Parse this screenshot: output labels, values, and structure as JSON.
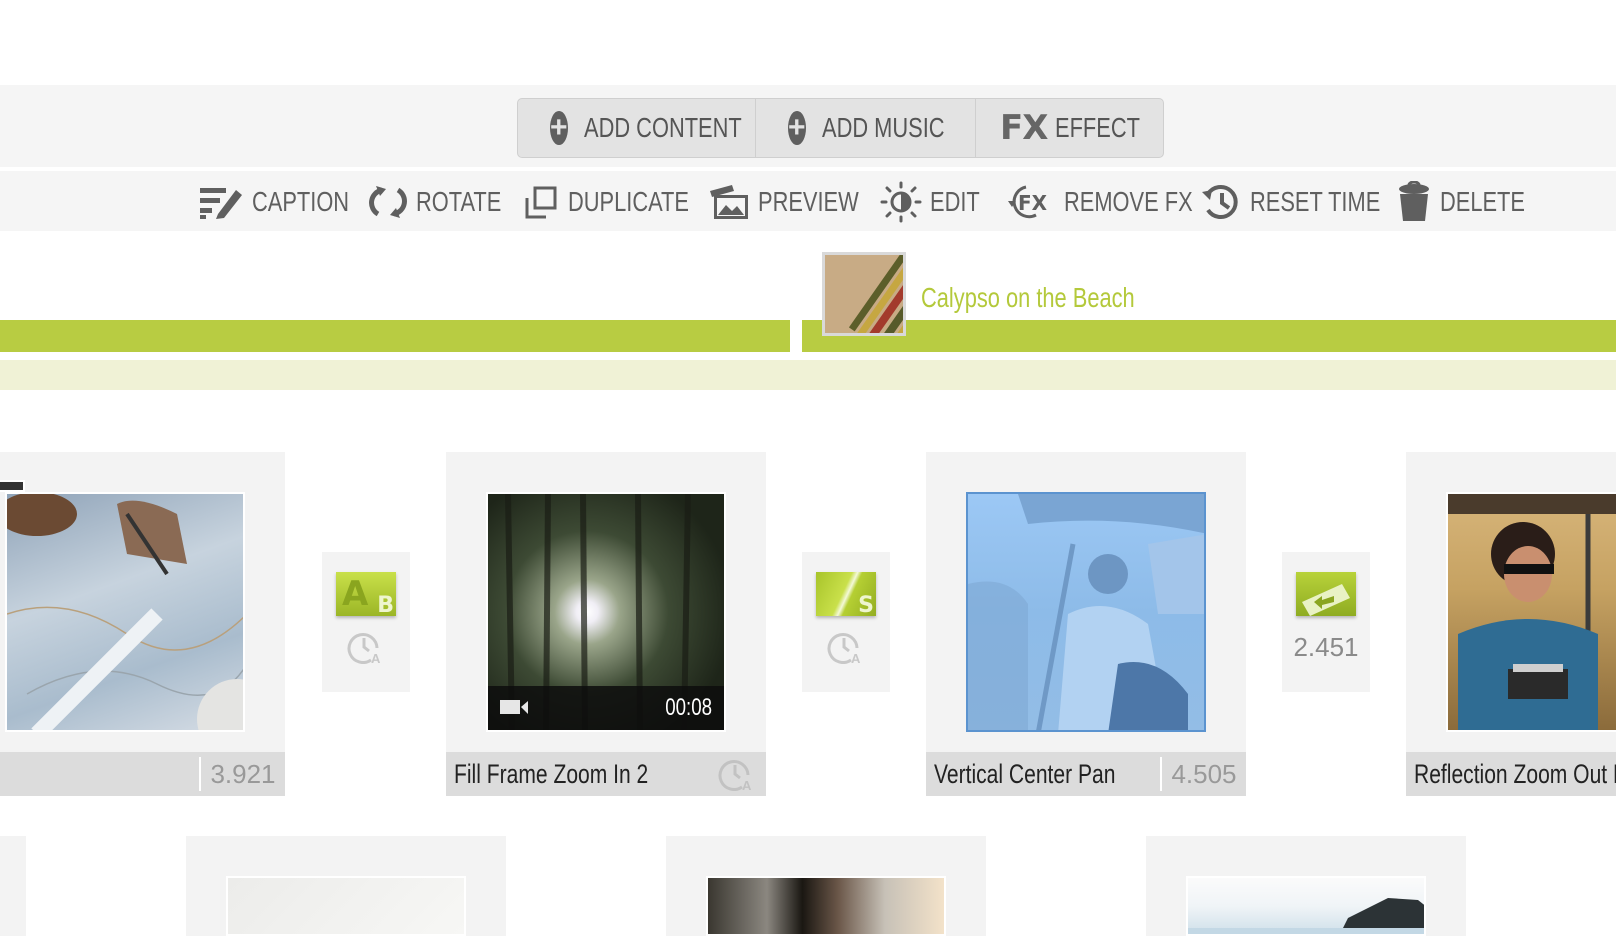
{
  "top_buttons": [
    {
      "label": "ADD CONTENT",
      "icon": "plus-circle-icon"
    },
    {
      "label": "ADD MUSIC",
      "icon": "plus-circle-icon"
    },
    {
      "label": "EFFECT",
      "icon": "fx-icon",
      "icon_text": "FX"
    }
  ],
  "toolbar": [
    {
      "label": "CAPTION",
      "icon": "caption-icon"
    },
    {
      "label": "ROTATE",
      "icon": "rotate-icon"
    },
    {
      "label": "DUPLICATE",
      "icon": "duplicate-icon"
    },
    {
      "label": "PREVIEW",
      "icon": "preview-icon"
    },
    {
      "label": "EDIT",
      "icon": "brightness-icon"
    },
    {
      "label": "REMOVE FX",
      "icon": "remove-fx-icon"
    },
    {
      "label": "RESET TIME",
      "icon": "history-icon"
    },
    {
      "label": "DELETE",
      "icon": "trash-icon"
    }
  ],
  "music": {
    "title": "Calypso on the Beach",
    "accent_color": "#b8cc42"
  },
  "slides": [
    {
      "title": "",
      "duration": "3.921",
      "type": "photo",
      "image": "map-with-pen"
    },
    {
      "title": "Fill Frame Zoom In 2",
      "duration": "",
      "video_duration": "00:08",
      "type": "video",
      "image": "forest-sunlight"
    },
    {
      "title": "Vertical Center Pan",
      "duration": "4.505",
      "type": "photo",
      "image": "woman-in-cart",
      "selected": true
    },
    {
      "title": "Reflection Zoom Out Da",
      "duration": "",
      "type": "photo",
      "image": "woman-with-camera"
    }
  ],
  "transitions": [
    {
      "icon": "ab-transition-icon",
      "letter": "B",
      "value": "",
      "auto_time": true
    },
    {
      "icon": "slide-transition-icon",
      "letter": "S",
      "value": "",
      "auto_time": true
    },
    {
      "icon": "arrow-transition-icon",
      "letter": "",
      "value": "2.451",
      "auto_time": false
    }
  ],
  "second_row": [
    {
      "image": "white-paper"
    },
    {
      "image": "palm-leaves"
    },
    {
      "image": "sea-island"
    }
  ],
  "auto_time_label": "A"
}
